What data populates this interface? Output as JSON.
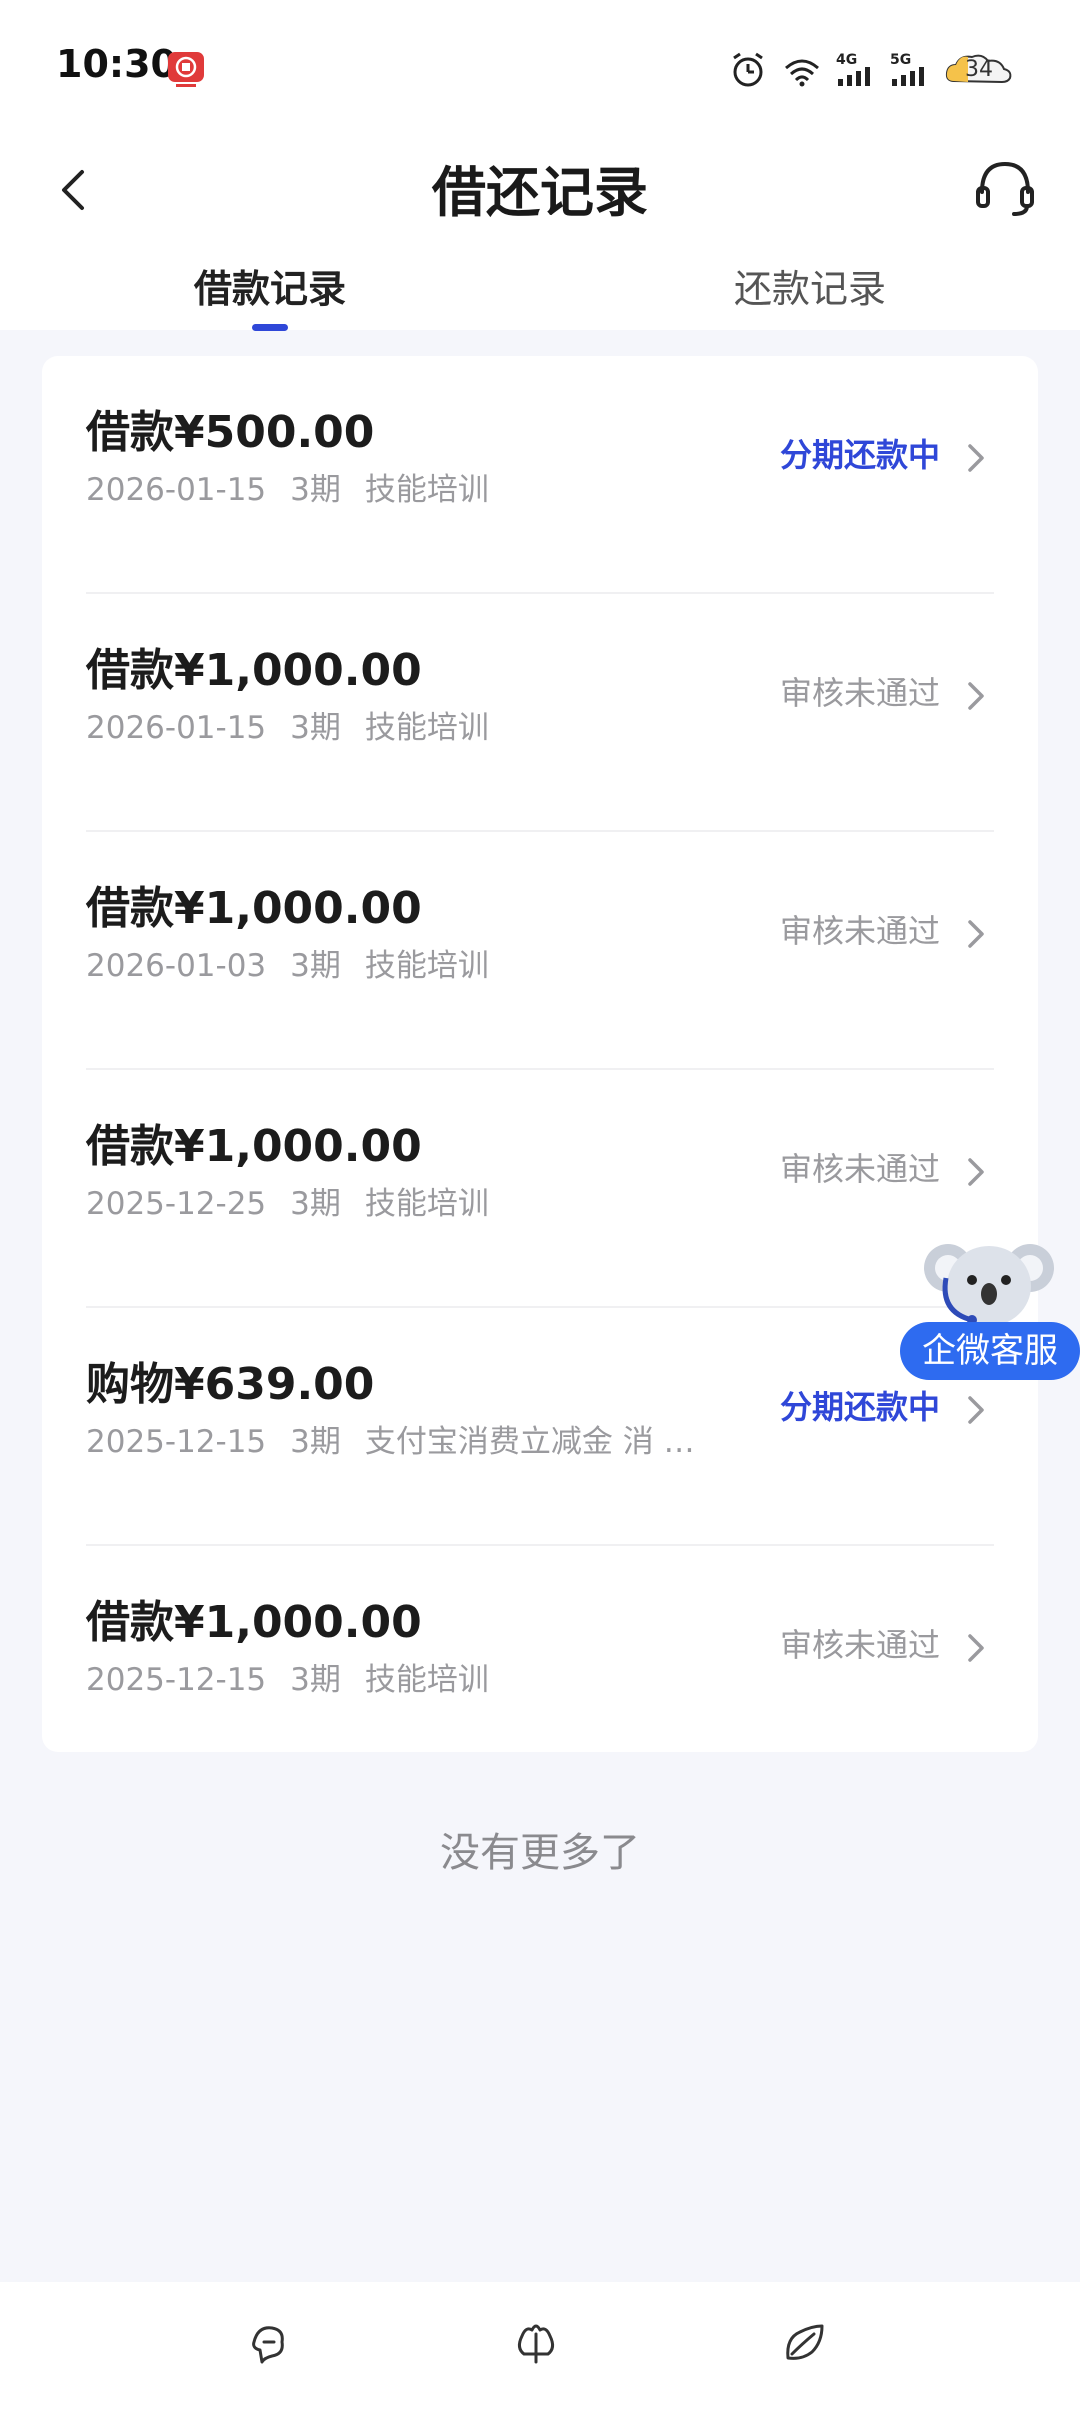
{
  "status_bar": {
    "time": "10:30",
    "network_4g": "4G",
    "network_5g": "5G",
    "battery": "34"
  },
  "header": {
    "title": "借还记录",
    "tabs": [
      {
        "label": "借款记录",
        "active": true
      },
      {
        "label": "还款记录",
        "active": false
      }
    ]
  },
  "records": [
    {
      "amount": "借款¥500.00",
      "date": "2026-01-15",
      "term": "3期",
      "purpose": "技能培训",
      "status": "分期还款中",
      "status_type": "active"
    },
    {
      "amount": "借款¥1,000.00",
      "date": "2026-01-15",
      "term": "3期",
      "purpose": "技能培训",
      "status": "审核未通过",
      "status_type": "rejected"
    },
    {
      "amount": "借款¥1,000.00",
      "date": "2026-01-03",
      "term": "3期",
      "purpose": "技能培训",
      "status": "审核未通过",
      "status_type": "rejected"
    },
    {
      "amount": "借款¥1,000.00",
      "date": "2025-12-25",
      "term": "3期",
      "purpose": "技能培训",
      "status": "审核未通过",
      "status_type": "rejected"
    },
    {
      "amount": "购物¥639.00",
      "date": "2025-12-15",
      "term": "3期",
      "purpose": "支付宝消费立减金 消 …",
      "status": "分期还款中",
      "status_type": "active"
    },
    {
      "amount": "借款¥1,000.00",
      "date": "2025-12-15",
      "term": "3期",
      "purpose": "技能培训",
      "status": "审核未通过",
      "status_type": "rejected"
    }
  ],
  "footer_note": "没有更多了",
  "floating_support": {
    "label": "企微客服"
  },
  "colors": {
    "accent": "#2F47D8",
    "support_button": "#2E6BF0",
    "muted": "#9A9A9E",
    "background": "#F5F6FB"
  }
}
